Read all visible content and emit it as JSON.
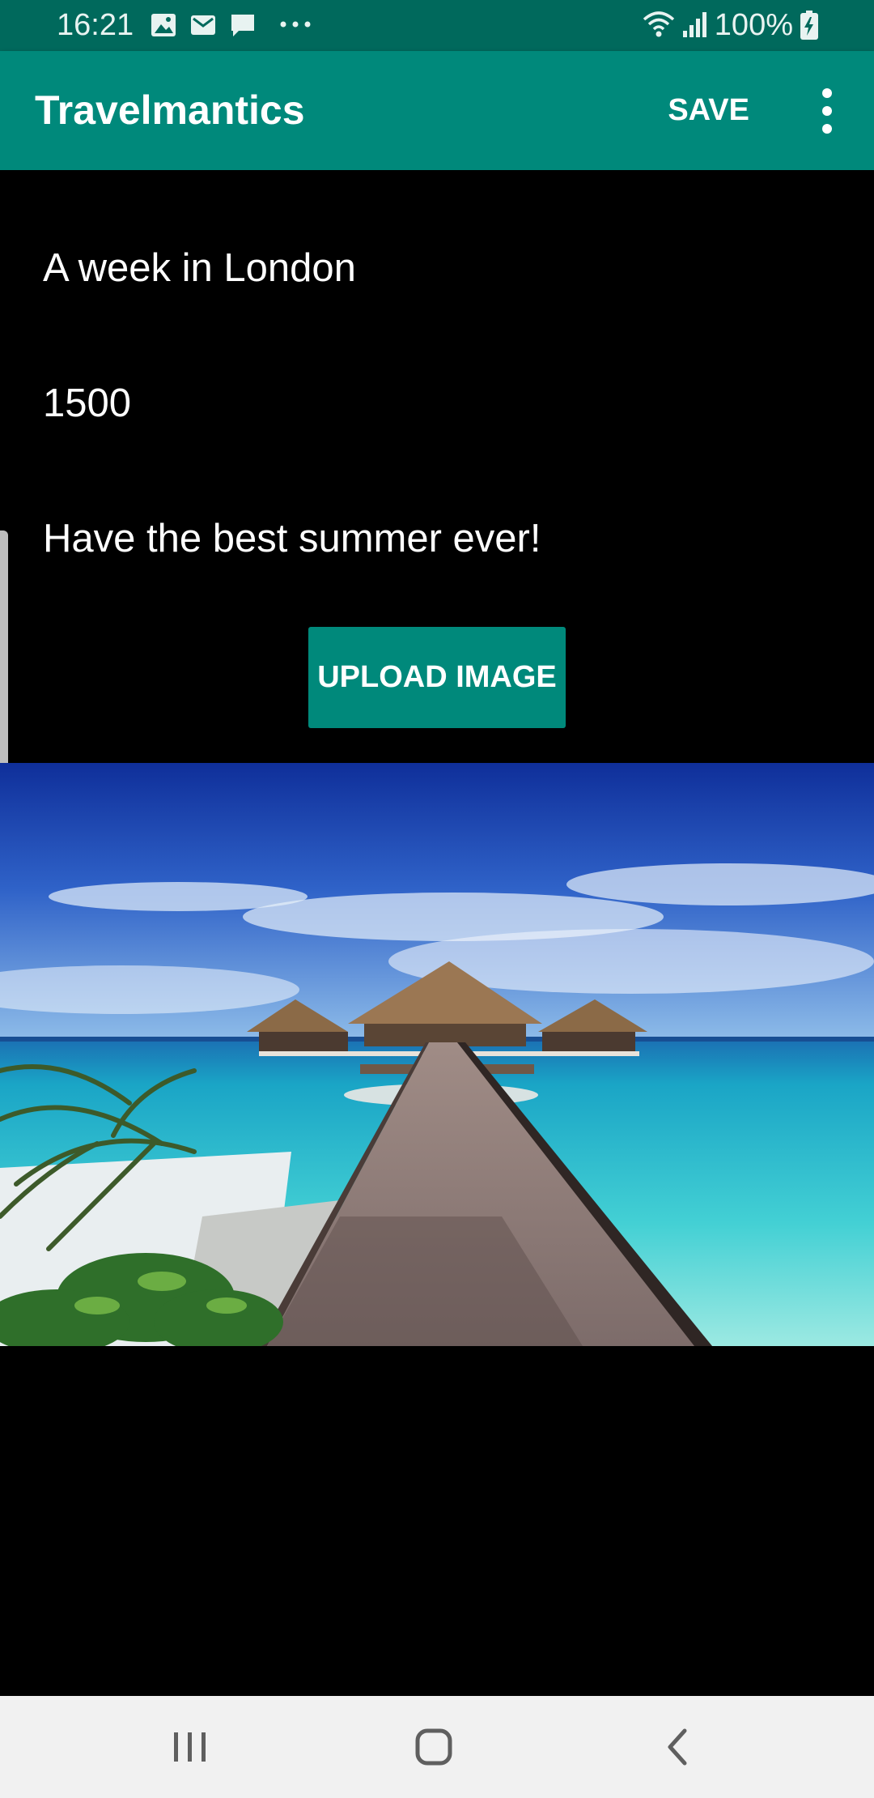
{
  "status_bar": {
    "time": "16:21",
    "battery_text": "100%",
    "icons": [
      "image-icon",
      "mail-icon",
      "chat-icon",
      "more-dots-icon",
      "wifi-icon",
      "signal-icon",
      "battery-charging-icon"
    ]
  },
  "app_bar": {
    "title": "Travelmantics",
    "save_label": "SAVE",
    "overflow_icon": "more-vert-icon"
  },
  "form": {
    "title_value": "A week in London",
    "price_value": "1500",
    "description_value": "Have the best summer ever!",
    "upload_label": "UPLOAD IMAGE"
  },
  "nav_bar": {
    "icons": [
      "recents-icon",
      "home-icon",
      "back-icon"
    ]
  },
  "colors": {
    "primary": "#00897b",
    "primary_dark": "#00695c",
    "background": "#000000",
    "nav_background": "#f1f1f1"
  }
}
